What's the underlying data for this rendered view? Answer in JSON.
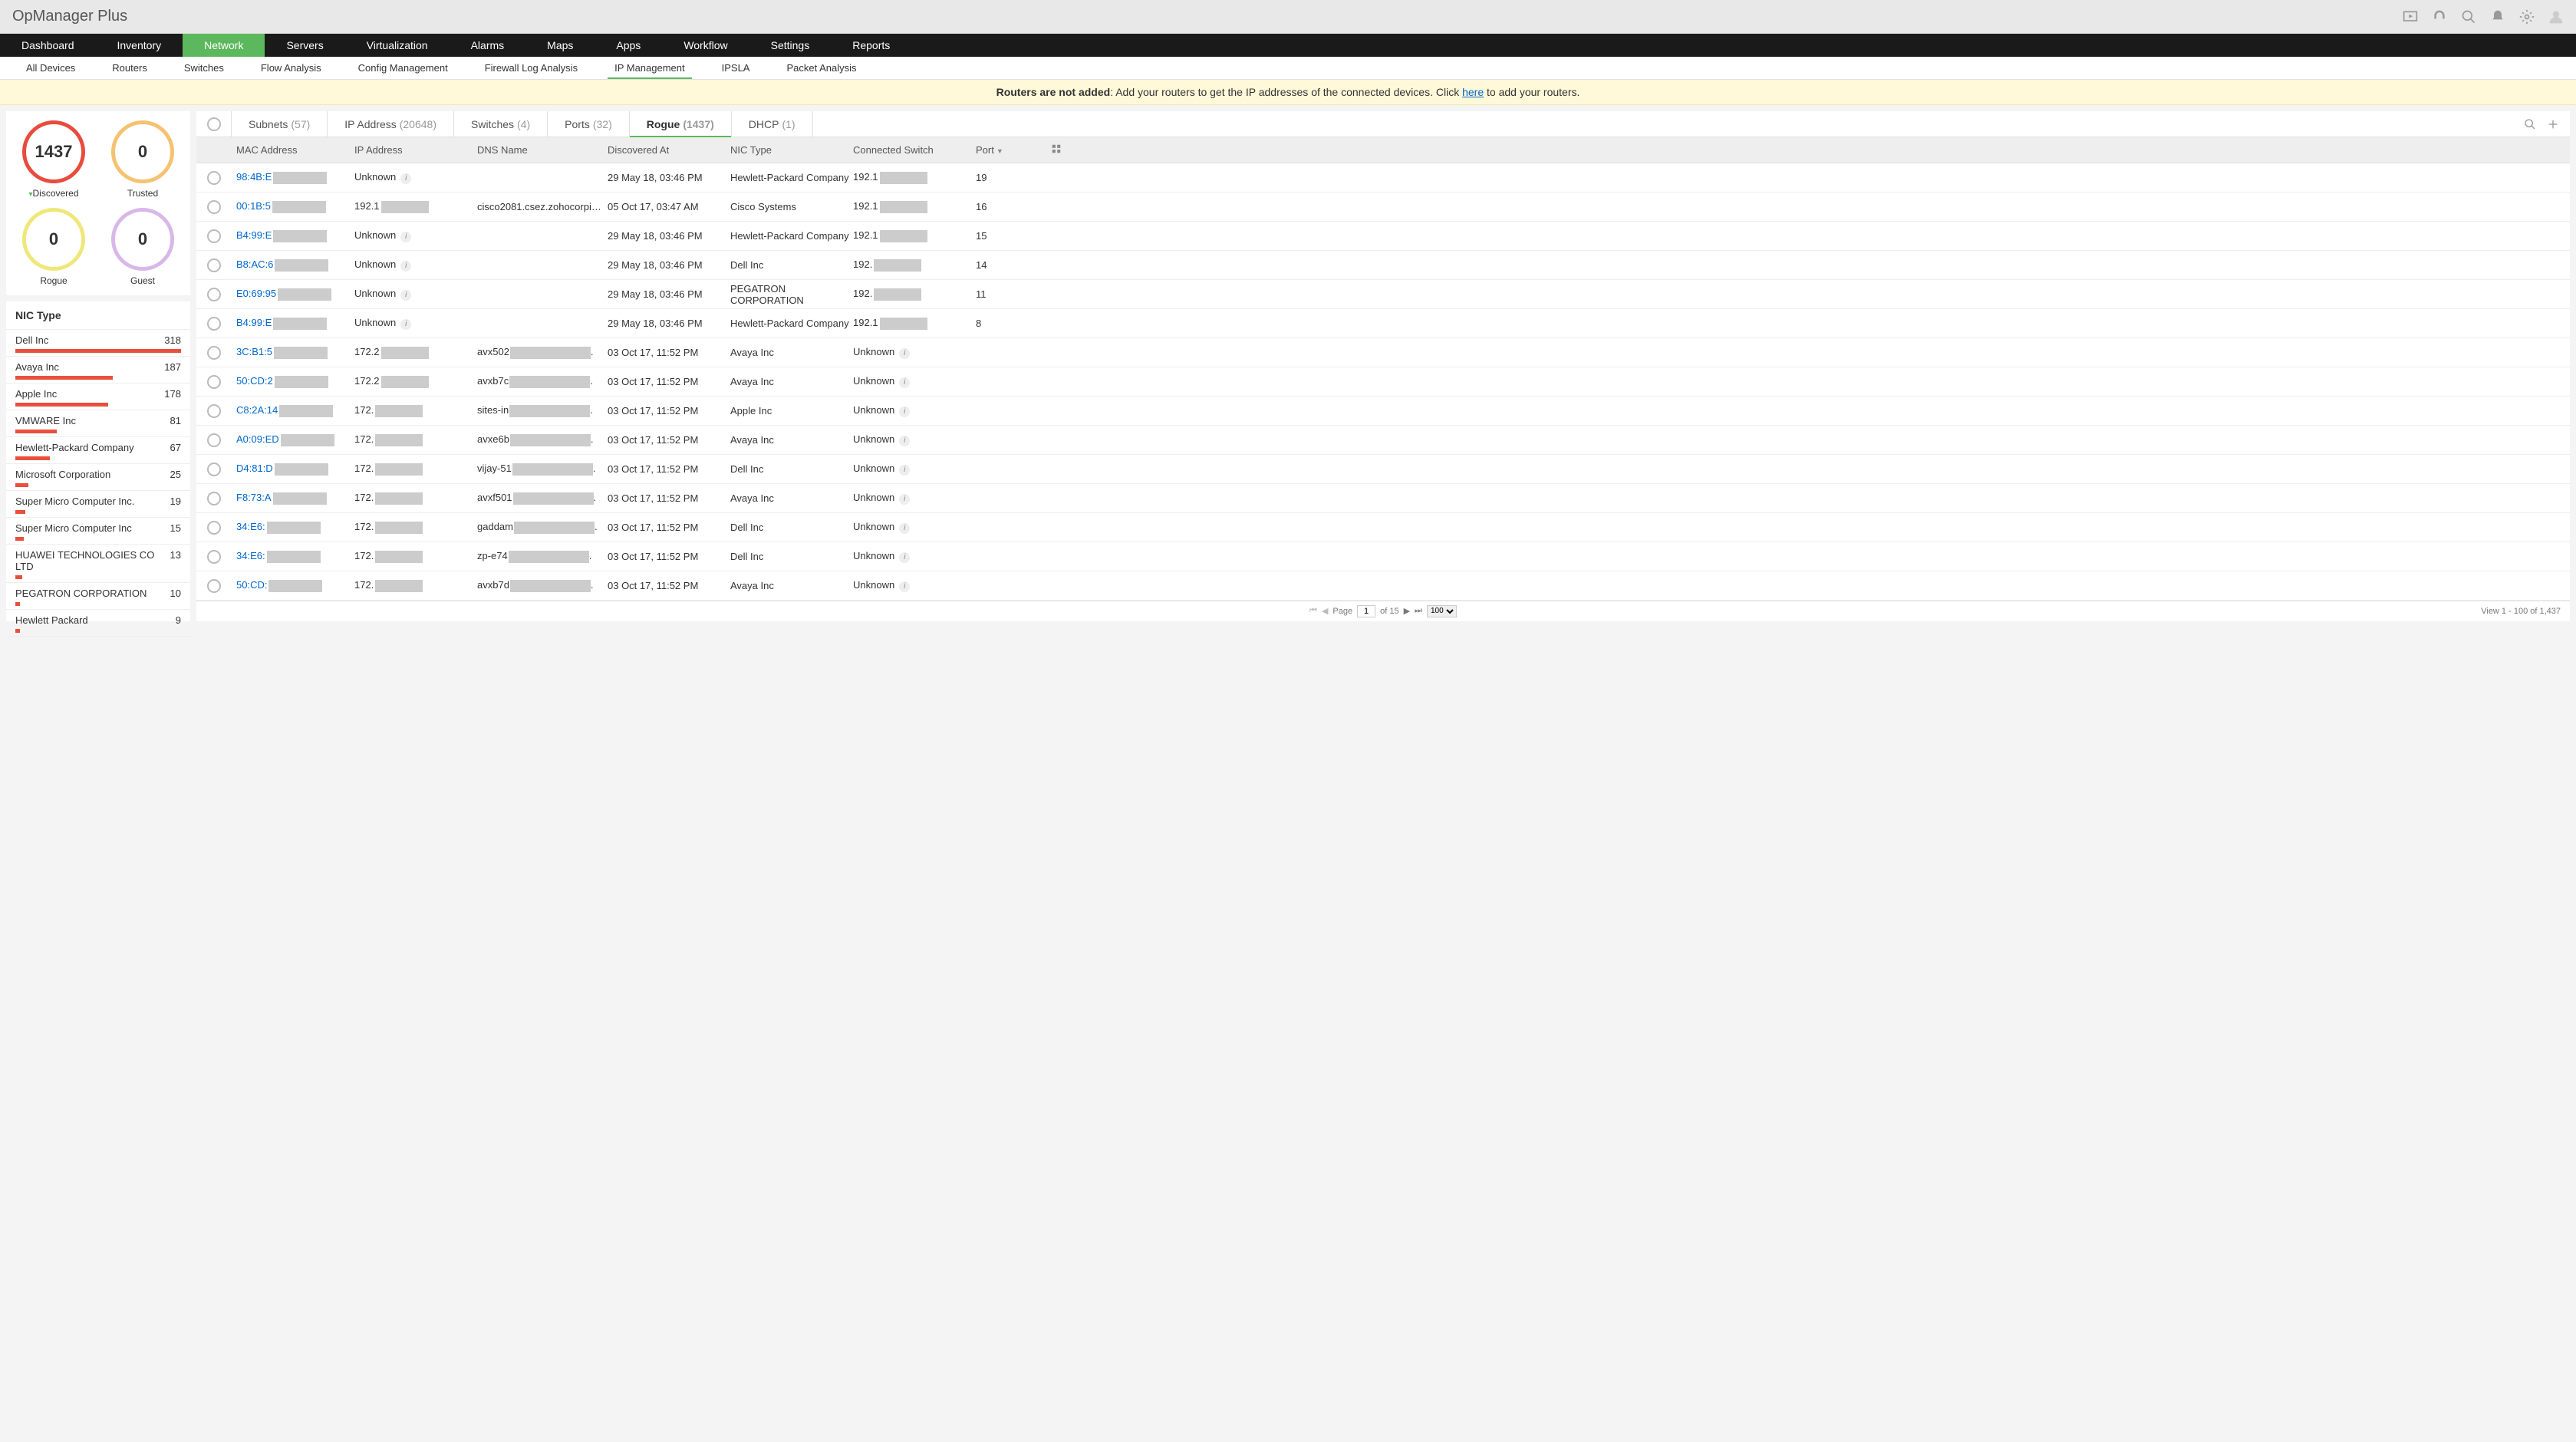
{
  "app_title": "OpManager Plus",
  "main_nav": [
    "Dashboard",
    "Inventory",
    "Network",
    "Servers",
    "Virtualization",
    "Alarms",
    "Maps",
    "Apps",
    "Workflow",
    "Settings",
    "Reports"
  ],
  "main_nav_active": "Network",
  "sub_nav": [
    "All Devices",
    "Routers",
    "Switches",
    "Flow Analysis",
    "Config Management",
    "Firewall Log Analysis",
    "IP Management",
    "IPSLA",
    "Packet Analysis"
  ],
  "sub_nav_active": "IP Management",
  "banner": {
    "bold": "Routers are not added",
    "text1": ": Add your routers to get the IP addresses of the connected devices. Click ",
    "link": "here",
    "text2": " to add your routers."
  },
  "stats": [
    {
      "value": "1437",
      "label": "Discovered",
      "class": "red",
      "caret": true
    },
    {
      "value": "0",
      "label": "Trusted",
      "class": "orange",
      "caret": false
    },
    {
      "value": "0",
      "label": "Rogue",
      "class": "yellow",
      "caret": false
    },
    {
      "value": "0",
      "label": "Guest",
      "class": "purple",
      "caret": false
    }
  ],
  "nic_header": "NIC Type",
  "nic_types": [
    {
      "name": "Dell Inc",
      "count": 318,
      "pct": 100
    },
    {
      "name": "Avaya Inc",
      "count": 187,
      "pct": 59
    },
    {
      "name": "Apple Inc",
      "count": 178,
      "pct": 56
    },
    {
      "name": "VMWARE Inc",
      "count": 81,
      "pct": 25
    },
    {
      "name": "Hewlett-Packard Company",
      "count": 67,
      "pct": 21
    },
    {
      "name": "Microsoft Corporation",
      "count": 25,
      "pct": 8
    },
    {
      "name": "Super Micro Computer Inc.",
      "count": 19,
      "pct": 6
    },
    {
      "name": "Super Micro Computer Inc",
      "count": 15,
      "pct": 5
    },
    {
      "name": "HUAWEI TECHNOLOGIES CO LTD",
      "count": 13,
      "pct": 4
    },
    {
      "name": "PEGATRON CORPORATION",
      "count": 10,
      "pct": 3
    },
    {
      "name": "Hewlett Packard",
      "count": 9,
      "pct": 3
    }
  ],
  "tabs": [
    {
      "label": "Subnets",
      "count": "(57)"
    },
    {
      "label": "IP Address",
      "count": "(20648)"
    },
    {
      "label": "Switches",
      "count": "(4)"
    },
    {
      "label": "Ports",
      "count": "(32)"
    },
    {
      "label": "Rogue",
      "count": "(1437)"
    },
    {
      "label": "DHCP",
      "count": "(1)"
    }
  ],
  "active_tab": "Rogue",
  "columns": [
    "MAC Address",
    "IP Address",
    "DNS Name",
    "Discovered At",
    "NIC Type",
    "Connected Switch",
    "Port"
  ],
  "rows": [
    {
      "mac": "98:4B:E",
      "ip": "Unknown",
      "ip_info": true,
      "dns": "",
      "discovered": "29 May 18, 03:46 PM",
      "nic": "Hewlett-Packard Company",
      "switch": "192.1",
      "port": "19"
    },
    {
      "mac": "00:1B:5",
      "ip": "192.1",
      "dns": "cisco2081.csez.zohocorpin....",
      "discovered": "05 Oct 17, 03:47 AM",
      "nic": "Cisco Systems",
      "switch": "192.1",
      "port": "16"
    },
    {
      "mac": "B4:99:E",
      "ip": "Unknown",
      "ip_info": true,
      "dns": "",
      "discovered": "29 May 18, 03:46 PM",
      "nic": "Hewlett-Packard Company",
      "switch": "192.1",
      "port": "15"
    },
    {
      "mac": "B8:AC:6",
      "ip": "Unknown",
      "ip_info": true,
      "dns": "",
      "discovered": "29 May 18, 03:46 PM",
      "nic": "Dell Inc",
      "switch": "192.",
      "port": "14"
    },
    {
      "mac": "E0:69:95",
      "ip": "Unknown",
      "ip_info": true,
      "dns": "",
      "discovered": "29 May 18, 03:46 PM",
      "nic": "PEGATRON CORPORATION",
      "switch": "192.",
      "port": "11"
    },
    {
      "mac": "B4:99:E",
      "ip": "Unknown",
      "ip_info": true,
      "dns": "",
      "discovered": "29 May 18, 03:46 PM",
      "nic": "Hewlett-Packard Company",
      "switch": "192.1",
      "port": "8"
    },
    {
      "mac": "3C:B1:5",
      "ip": "172.2",
      "dns": "avx502",
      "dns_trail": ".",
      "discovered": "03 Oct 17, 11:52 PM",
      "nic": "Avaya Inc",
      "switch": "Unknown",
      "switch_info": true,
      "port": ""
    },
    {
      "mac": "50:CD:2",
      "ip": "172.2",
      "dns": "avxb7c",
      "dns_trail": ".",
      "discovered": "03 Oct 17, 11:52 PM",
      "nic": "Avaya Inc",
      "switch": "Unknown",
      "switch_info": true,
      "port": ""
    },
    {
      "mac": "C8:2A:14",
      "ip": "172.",
      "dns": "sites-in",
      "dns_trail": ".",
      "discovered": "03 Oct 17, 11:52 PM",
      "nic": "Apple Inc",
      "switch": "Unknown",
      "switch_info": true,
      "port": ""
    },
    {
      "mac": "A0:09:ED",
      "ip": "172.",
      "dns": "avxe6b",
      "dns_trail": ".",
      "discovered": "03 Oct 17, 11:52 PM",
      "nic": "Avaya Inc",
      "switch": "Unknown",
      "switch_info": true,
      "port": ""
    },
    {
      "mac": "D4:81:D",
      "ip": "172.",
      "dns": "vijay-51",
      "dns_trail": ".",
      "discovered": "03 Oct 17, 11:52 PM",
      "nic": "Dell Inc",
      "switch": "Unknown",
      "switch_info": true,
      "port": ""
    },
    {
      "mac": "F8:73:A",
      "ip": "172.",
      "dns": "avxf501",
      "dns_trail": ".",
      "discovered": "03 Oct 17, 11:52 PM",
      "nic": "Avaya Inc",
      "switch": "Unknown",
      "switch_info": true,
      "port": ""
    },
    {
      "mac": "34:E6:",
      "ip": "172.",
      "dns": "gaddam",
      "dns_trail": ".",
      "discovered": "03 Oct 17, 11:52 PM",
      "nic": "Dell Inc",
      "switch": "Unknown",
      "switch_info": true,
      "port": ""
    },
    {
      "mac": "34:E6:",
      "ip": "172.",
      "dns": "zp-e74",
      "dns_trail": ".",
      "discovered": "03 Oct 17, 11:52 PM",
      "nic": "Dell Inc",
      "switch": "Unknown",
      "switch_info": true,
      "port": ""
    },
    {
      "mac": "50:CD:",
      "ip": "172.",
      "dns": "avxb7d",
      "dns_trail": ".",
      "discovered": "03 Oct 17, 11:52 PM",
      "nic": "Avaya Inc",
      "switch": "Unknown",
      "switch_info": true,
      "port": ""
    }
  ],
  "pager": {
    "page_label": "Page",
    "page": "1",
    "of": "of 15",
    "per_page": "100",
    "view_text": "View 1 - 100 of 1,437"
  },
  "chart_data": {
    "type": "bar",
    "title": "NIC Type",
    "categories": [
      "Dell Inc",
      "Avaya Inc",
      "Apple Inc",
      "VMWARE Inc",
      "Hewlett-Packard Company",
      "Microsoft Corporation",
      "Super Micro Computer Inc.",
      "Super Micro Computer Inc",
      "HUAWEI TECHNOLOGIES CO LTD",
      "PEGATRON CORPORATION",
      "Hewlett Packard"
    ],
    "values": [
      318,
      187,
      178,
      81,
      67,
      25,
      19,
      15,
      13,
      10,
      9
    ],
    "xlabel": "",
    "ylabel": "",
    "ylim": [
      0,
      318
    ]
  }
}
